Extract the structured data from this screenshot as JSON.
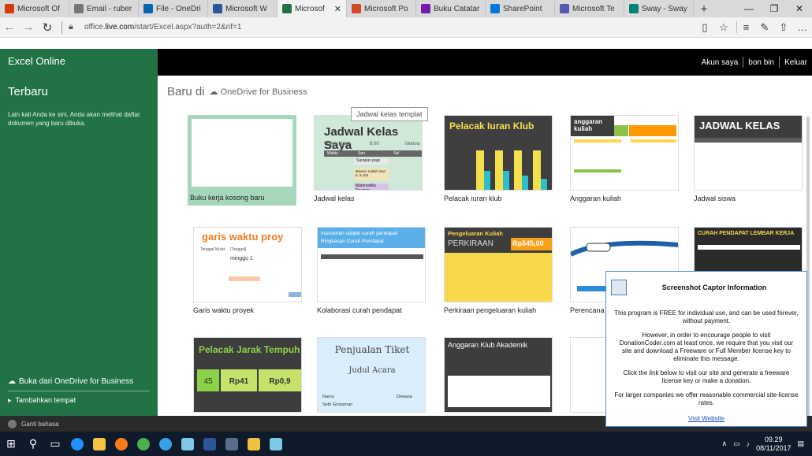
{
  "browser": {
    "tabs": [
      {
        "label": "Microsoft Of",
        "icon": "office-icon",
        "color": "#d83b01"
      },
      {
        "label": "Email - ruber",
        "icon": "mail-icon",
        "color": "#777777"
      },
      {
        "label": "File - OneDri",
        "icon": "onedrive-icon",
        "color": "#0a64ad"
      },
      {
        "label": "Microsoft W",
        "icon": "word-icon",
        "color": "#2b579a"
      },
      {
        "label": "Microsof",
        "icon": "excel-icon",
        "color": "#217346",
        "active": true
      },
      {
        "label": "Microsoft Po",
        "icon": "powerpoint-icon",
        "color": "#d24726"
      },
      {
        "label": "Buku Catatar",
        "icon": "onenote-icon",
        "color": "#7719aa"
      },
      {
        "label": "SharePoint",
        "icon": "sharepoint-icon",
        "color": "#0078d7"
      },
      {
        "label": "Microsoft Te",
        "icon": "teams-icon",
        "color": "#5558af"
      },
      {
        "label": "Sway - Sway",
        "icon": "sway-icon",
        "color": "#008272"
      }
    ],
    "new_tab": "+",
    "url_host": "office.",
    "url_domain": "live.com",
    "url_path": "/start/Excel.aspx?auth=2&nf=1",
    "window_buttons": [
      "—",
      "❐",
      "✕"
    ]
  },
  "app": {
    "title": "Excel Online",
    "account_label": "Akun saya",
    "user_name": "bon bin",
    "signout": "Keluar"
  },
  "sidebar": {
    "heading": "Terbaru",
    "description": "Lain kali Anda ke sini, Anda akan melihat daftar dokumen yang baru dibuka.",
    "open_onedrive": "Buka dari OneDrive for Business",
    "add_place": "Tambahkan tempat"
  },
  "main": {
    "new_in": "Baru di",
    "location": "OneDrive for Business",
    "tooltip": "Jadwal kelas templat",
    "templates": [
      {
        "name": "Buku kerja kosong baru",
        "title": ""
      },
      {
        "name": "Jadwal kelas",
        "title": "Jadwal Kelas Saya"
      },
      {
        "name": "Pelacak iuran klub",
        "title": "Pelacak Iuran Klub"
      },
      {
        "name": "Anggaran kuliah",
        "title": "anggaran kuliah"
      },
      {
        "name": "Jadwal siswa",
        "title": "JADWAL KELAS"
      },
      {
        "name": "Garis waktu proyek",
        "title": "garis waktu proy"
      },
      {
        "name": "Kolaborasi curah pendapat",
        "title": "masukkan subjek curah pendapat"
      },
      {
        "name": "Perkiraan pengeluaran kuliah",
        "title": "Pengeluaran Kuliah"
      },
      {
        "name": "Perencana p",
        "title": ""
      },
      {
        "name": "",
        "title": "CURAH PENDAPAT LEMBAR KERJA"
      },
      {
        "name": "",
        "title": "Pelacak Jarak Tempuh"
      },
      {
        "name": "",
        "title": "Penjualan Tiket"
      },
      {
        "name": "",
        "title": "Anggaran Klub Akademik"
      },
      {
        "name": "",
        "title": ""
      }
    ],
    "thumb_text": {
      "jadwal_waktu": "Waktu Mulai",
      "jadwal_time": "8:00",
      "jadwal_interval": "Interva",
      "jadwal_col1": "Waktu",
      "jadwal_col2": "Sen",
      "jadwal_col3": "Sel",
      "jadwal_class": "Sarapan pagi",
      "jadwal_class2": "Biarea: Kuliah Ged 6, 6.104",
      "jadwal_class3": "Matematika Terapan",
      "perkiraan_label": "PERKIRAAN",
      "perkiraan_value": "Rp545,00",
      "pelacak_km": "45",
      "pelacak_rp1": "Rp41",
      "pelacak_rp2": "Rp0,9",
      "tiket_sub": "Judul Acara",
      "tiket_name": "Nama",
      "tiket_name2": "Seth Grossman",
      "tiket_dewasa": "Dewasa",
      "garis_minggu": "minggu 1",
      "garis_tanggal": "Tanggal Mulai:",
      "garis_tanggal_val": "[Tanggal]",
      "kolab_sub": "Ringkasan Curah Pendapat"
    }
  },
  "dialog": {
    "title": "Screenshot Captor Information",
    "p1": "This program is FREE for individual use, and can be used forever, without payment.",
    "p2": "However, in order to encourage people to visit DonationCoder.com at least once, we require that you visit our site and download a Freeware or Full Member license key to eliminate this message.",
    "p3": "Click the link below to visit our site and generate a freeware license key or make a donation.",
    "p4": "For larger companies we offer reasonable commercial site-license rates.",
    "link": "Visit Website"
  },
  "status": {
    "language": "Ganti bahasa"
  },
  "taskbar": {
    "time": "09.29",
    "date": "08/11/2017"
  }
}
